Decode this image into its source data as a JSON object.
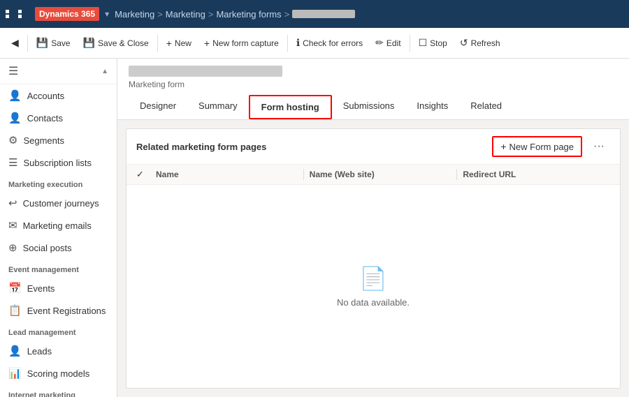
{
  "topbar": {
    "app_name": "Dynamics 365",
    "module": "Marketing",
    "breadcrumb1": "Marketing",
    "breadcrumb2": "Marketing forms",
    "breadcrumb_sep": ">"
  },
  "toolbar": {
    "back_label": "",
    "save_label": "Save",
    "save_close_label": "Save & Close",
    "new_label": "New",
    "new_form_capture_label": "New form capture",
    "check_errors_label": "Check for errors",
    "edit_label": "Edit",
    "stop_label": "Stop",
    "refresh_label": "Refresh"
  },
  "sidebar": {
    "hamburger": "≡",
    "items": [
      {
        "id": "accounts",
        "label": "Accounts",
        "icon": "👤"
      },
      {
        "id": "contacts",
        "label": "Contacts",
        "icon": "👤"
      },
      {
        "id": "segments",
        "label": "Segments",
        "icon": "⚙"
      },
      {
        "id": "subscription-lists",
        "label": "Subscription lists",
        "icon": "☰"
      },
      {
        "id": "marketing-execution",
        "label": "Marketing execution",
        "type": "section"
      },
      {
        "id": "customer-journeys",
        "label": "Customer journeys",
        "icon": "↩"
      },
      {
        "id": "marketing-emails",
        "label": "Marketing emails",
        "icon": "✉"
      },
      {
        "id": "social-posts",
        "label": "Social posts",
        "icon": "⊕"
      },
      {
        "id": "event-management",
        "label": "Event management",
        "type": "section"
      },
      {
        "id": "events",
        "label": "Events",
        "icon": "📅"
      },
      {
        "id": "event-registrations",
        "label": "Event Registrations",
        "icon": "📋"
      },
      {
        "id": "lead-management",
        "label": "Lead management",
        "type": "section"
      },
      {
        "id": "leads",
        "label": "Leads",
        "icon": "👤"
      },
      {
        "id": "scoring-models",
        "label": "Scoring models",
        "icon": "📊"
      },
      {
        "id": "internet-marketing",
        "label": "Internet marketing",
        "type": "section"
      }
    ]
  },
  "record": {
    "title_placeholder": "record title blurred",
    "subtitle": "Marketing form"
  },
  "tabs": [
    {
      "id": "designer",
      "label": "Designer",
      "active": false
    },
    {
      "id": "summary",
      "label": "Summary",
      "active": false
    },
    {
      "id": "form-hosting",
      "label": "Form hosting",
      "active": true
    },
    {
      "id": "submissions",
      "label": "Submissions",
      "active": false
    },
    {
      "id": "insights",
      "label": "Insights",
      "active": false
    },
    {
      "id": "related",
      "label": "Related",
      "active": false
    }
  ],
  "panel": {
    "title": "Related marketing form pages",
    "new_form_page_label": "New Form page",
    "more_icon": "···",
    "columns": [
      {
        "id": "name",
        "label": "Name"
      },
      {
        "id": "website",
        "label": "Name (Web site)"
      },
      {
        "id": "redirect",
        "label": "Redirect URL"
      }
    ],
    "no_data_text": "No data available."
  }
}
